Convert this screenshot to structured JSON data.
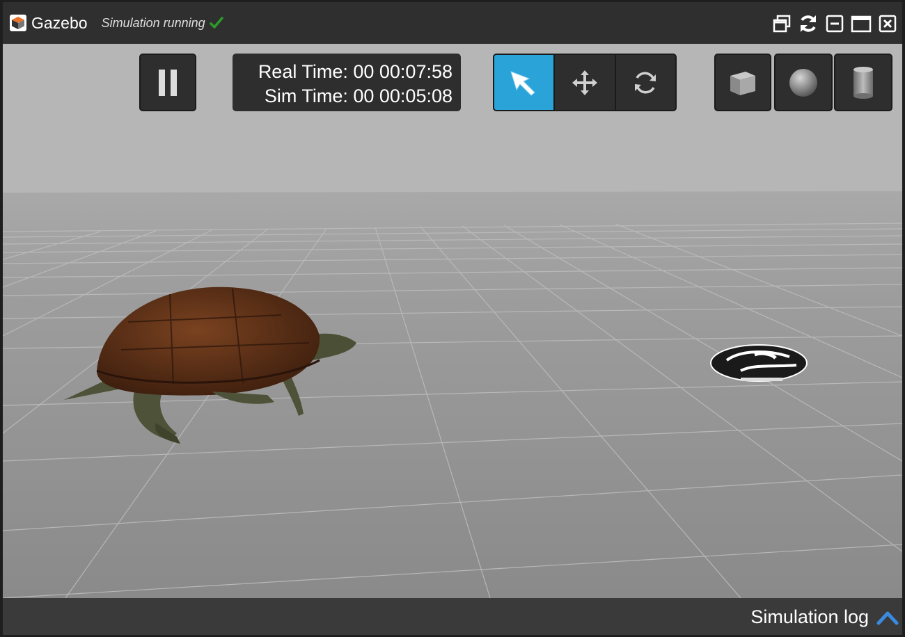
{
  "window": {
    "title": "Gazebo",
    "status": "Simulation running"
  },
  "titlebar_icons": [
    "gazebo-logo-icon",
    "checkmark-icon",
    "restore-window-icon",
    "refresh-icon",
    "minimize-icon",
    "maximize-icon",
    "close-icon"
  ],
  "toolbar": {
    "pause_icon": "pause-icon",
    "real_time": "Real Time: 00 00:07:58",
    "sim_time": "Sim Time: 00 00:05:08",
    "modes": [
      {
        "icon": "select-arrow-icon",
        "active": true
      },
      {
        "icon": "translate-icon",
        "active": false
      },
      {
        "icon": "rotate-icon",
        "active": false
      }
    ],
    "shapes": [
      "box-icon",
      "sphere-icon",
      "cylinder-icon"
    ]
  },
  "scene_objects": [
    "turtle-model",
    "robot-vacuum-model"
  ],
  "log": {
    "label": "Simulation log"
  },
  "colors": {
    "accent": "#2aa4d8",
    "titlebar": "#2f2f2f",
    "logbar": "#3a3a3a",
    "status_check": "#2c9b2c"
  }
}
